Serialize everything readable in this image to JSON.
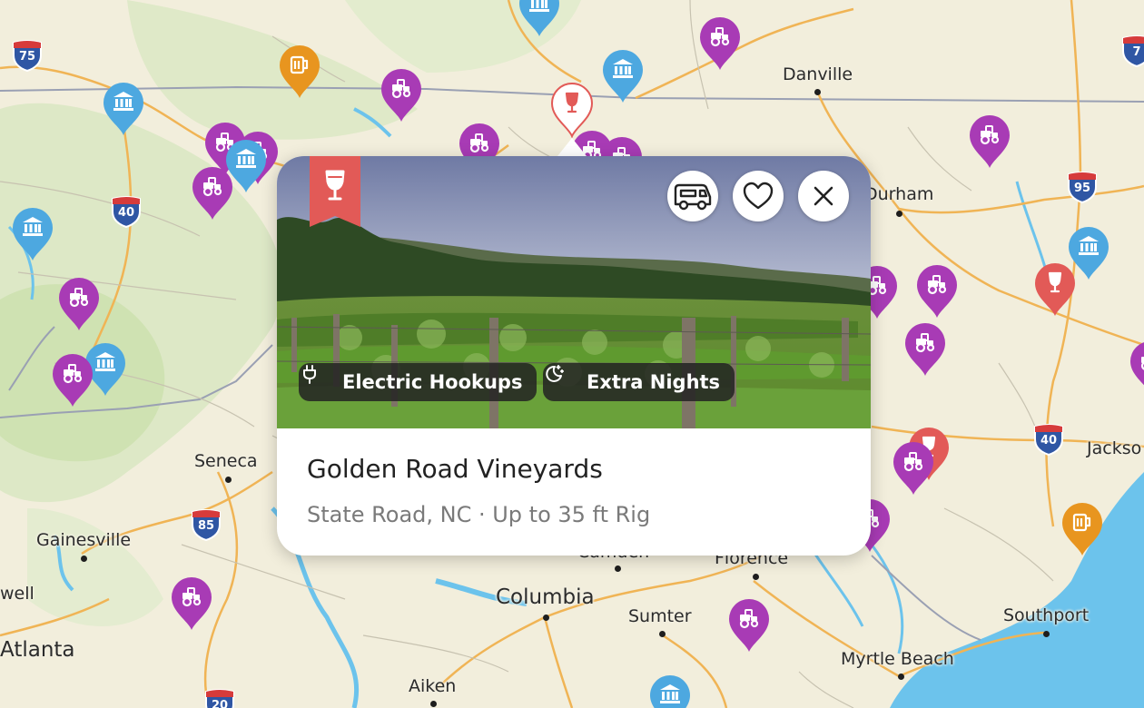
{
  "map": {
    "cities": [
      {
        "name": "Danville",
        "size": "normal"
      },
      {
        "name": "Durham",
        "size": "normal"
      },
      {
        "name": "Jackso",
        "size": "normal"
      },
      {
        "name": "Seneca",
        "size": "normal"
      },
      {
        "name": "Gainesville",
        "size": "normal"
      },
      {
        "name": "Columbia",
        "size": "big"
      },
      {
        "name": "Sumter",
        "size": "normal"
      },
      {
        "name": "Florence",
        "size": "normal"
      },
      {
        "name": "Camden",
        "size": "normal"
      },
      {
        "name": "Myrtle Beach",
        "size": "normal"
      },
      {
        "name": "Southport",
        "size": "normal"
      },
      {
        "name": "Aiken",
        "size": "normal"
      },
      {
        "name": "Atlanta",
        "size": "big"
      },
      {
        "name": "well",
        "size": "normal"
      }
    ],
    "shields": [
      {
        "number": "75",
        "type": "interstate"
      },
      {
        "number": "40",
        "type": "interstate"
      },
      {
        "number": "95",
        "type": "interstate"
      },
      {
        "number": "40",
        "type": "interstate"
      },
      {
        "number": "85",
        "type": "interstate"
      },
      {
        "number": "20",
        "type": "interstate"
      },
      {
        "number": "7",
        "type": "interstate"
      }
    ],
    "pins": [
      {
        "category": "farm",
        "icon": "tractor-icon",
        "color": "#a83bb5"
      },
      {
        "category": "brewery",
        "icon": "beer-mug-icon",
        "color": "#e8951f"
      },
      {
        "category": "museum",
        "icon": "museum-icon",
        "color": "#4da8e0"
      },
      {
        "category": "winery",
        "icon": "wine-glass-icon",
        "color": "#e25a57"
      }
    ]
  },
  "popup": {
    "category_icon": "wine-glass-icon",
    "ribbon_color": "#e25a57",
    "actions": {
      "rv_icon": "rv-icon",
      "favorite_icon": "heart-icon",
      "close_icon": "close-icon"
    },
    "amenities": [
      {
        "label": "Electric Hookups",
        "icon": "plug-icon"
      },
      {
        "label": "Extra Nights",
        "icon": "moon-stars-icon"
      }
    ],
    "title": "Golden Road Vineyards",
    "subtitle": "State Road, NC · Up to 35 ft Rig"
  }
}
